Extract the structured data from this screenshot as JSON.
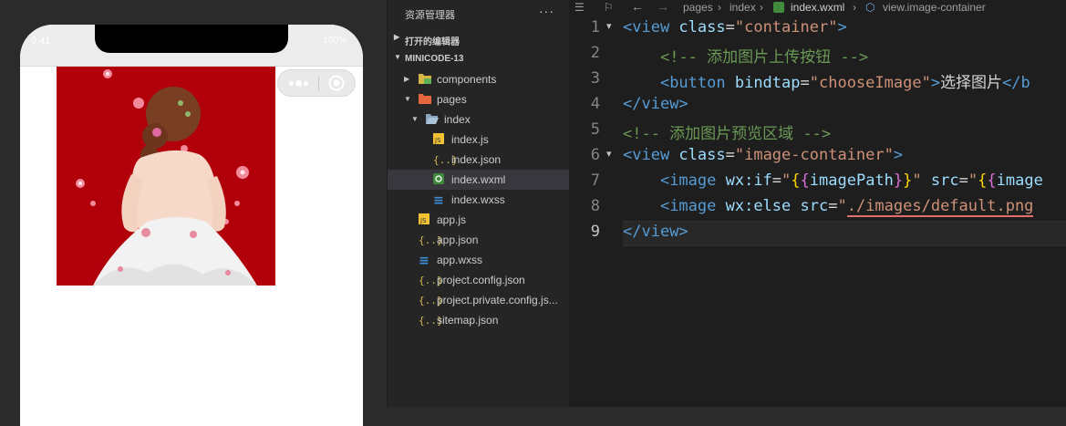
{
  "simulator": {
    "status_time": "9:41",
    "status_right": "100%",
    "preview_image": "girl-in-white-dress-illustration",
    "colors": {
      "preview_bg": "#b1000a"
    }
  },
  "explorer": {
    "title": "资源管理器",
    "more": "···",
    "sections": {
      "open_editors": "打开的编辑器",
      "project": "MINICODE-13"
    },
    "tree": [
      {
        "name": "components",
        "type": "folder",
        "icon": "folder-icon"
      },
      {
        "name": "pages",
        "type": "folder",
        "icon": "folder-icon"
      },
      {
        "name": "index",
        "type": "folder",
        "icon": "folder-open-icon"
      },
      {
        "name": "index.js",
        "type": "file",
        "icon": "js-file-icon"
      },
      {
        "name": "index.json",
        "type": "file",
        "icon": "json-file-icon"
      },
      {
        "name": "index.wxml",
        "type": "file",
        "icon": "wxml-file-icon",
        "selected": true
      },
      {
        "name": "index.wxss",
        "type": "file",
        "icon": "css-file-icon"
      },
      {
        "name": "app.js",
        "type": "file",
        "icon": "js-file-icon"
      },
      {
        "name": "app.json",
        "type": "file",
        "icon": "json-file-icon"
      },
      {
        "name": "app.wxss",
        "type": "file",
        "icon": "css-file-icon"
      },
      {
        "name": "project.config.json",
        "type": "file",
        "icon": "json-file-icon"
      },
      {
        "name": "project.private.config.js...",
        "type": "file",
        "icon": "json-file-icon"
      },
      {
        "name": "sitemap.json",
        "type": "file",
        "icon": "json-file-icon"
      }
    ]
  },
  "editor": {
    "breadcrumb": [
      "pages",
      "index",
      "index.wxml",
      "view.image-container"
    ],
    "current_line": 9,
    "lines": [
      {
        "num": "1",
        "tokens": [
          [
            "t",
            "<view "
          ],
          [
            "a",
            "class"
          ],
          [
            "p",
            "="
          ],
          [
            "s",
            "\"container\""
          ],
          [
            "t",
            ">"
          ]
        ]
      },
      {
        "num": "2",
        "tokens": [
          [
            "p",
            "    "
          ],
          [
            "c",
            "<!-- 添加图片上传按钮 -->"
          ]
        ]
      },
      {
        "num": "3",
        "tokens": [
          [
            "p",
            "    "
          ],
          [
            "t",
            "<button "
          ],
          [
            "a",
            "bindtap"
          ],
          [
            "p",
            "="
          ],
          [
            "s",
            "\"chooseImage\""
          ],
          [
            "t",
            ">"
          ],
          [
            "p",
            "选择图片"
          ],
          [
            "t",
            "</b"
          ]
        ]
      },
      {
        "num": "4",
        "tokens": [
          [
            "t",
            "</view>"
          ]
        ]
      },
      {
        "num": "5",
        "tokens": [
          [
            "c",
            "<!-- 添加图片预览区域 -->"
          ]
        ]
      },
      {
        "num": "6",
        "tokens": [
          [
            "t",
            "<view "
          ],
          [
            "a",
            "class"
          ],
          [
            "p",
            "="
          ],
          [
            "s",
            "\"image-container\""
          ],
          [
            "t",
            ">"
          ]
        ]
      },
      {
        "num": "7",
        "tokens": [
          [
            "p",
            "    "
          ],
          [
            "t",
            "<image "
          ],
          [
            "a",
            "wx:if"
          ],
          [
            "p",
            "="
          ],
          [
            "s",
            "\""
          ],
          [
            "y",
            "{"
          ],
          [
            "m",
            "{"
          ],
          [
            "a",
            "imagePath"
          ],
          [
            "m",
            "}"
          ],
          [
            "y",
            "}"
          ],
          [
            "s",
            "\""
          ],
          [
            "p",
            " "
          ],
          [
            "a",
            "src"
          ],
          [
            "p",
            "="
          ],
          [
            "s",
            "\""
          ],
          [
            "y",
            "{"
          ],
          [
            "m",
            "{"
          ],
          [
            "a",
            "image"
          ]
        ]
      },
      {
        "num": "8",
        "tokens": [
          [
            "p",
            "    "
          ],
          [
            "t",
            "<image "
          ],
          [
            "a",
            "wx:else "
          ],
          [
            "a",
            "src"
          ],
          [
            "p",
            "="
          ],
          [
            "s",
            "\""
          ],
          [
            "su",
            "./images/default.png"
          ]
        ]
      },
      {
        "num": "9",
        "tokens": [
          [
            "t",
            "</view>"
          ]
        ]
      }
    ]
  }
}
